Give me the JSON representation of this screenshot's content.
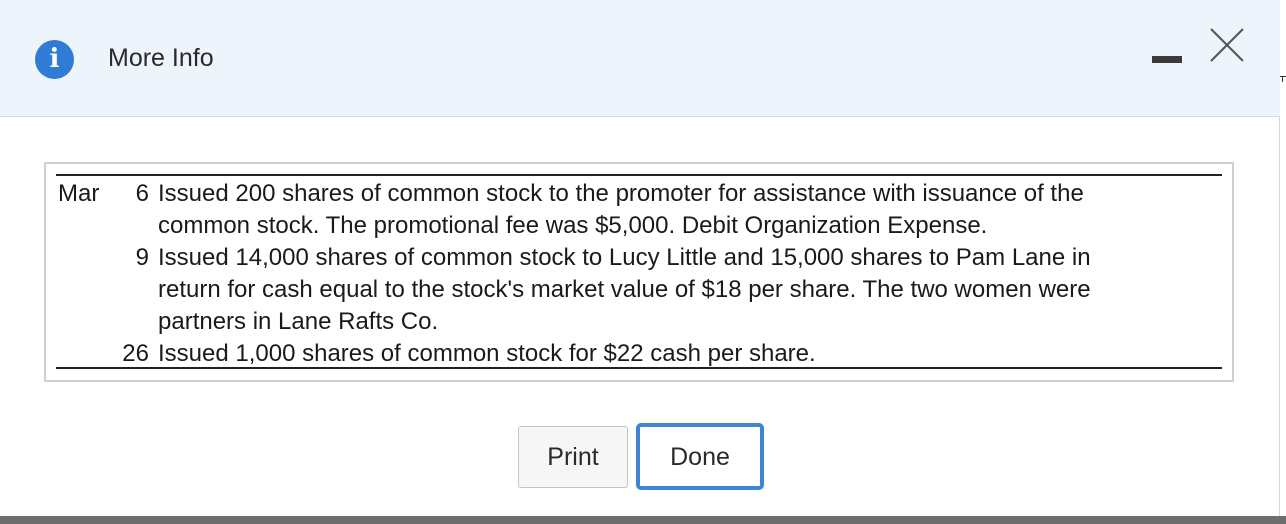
{
  "dialog": {
    "title": "More Info",
    "info_icon": "i",
    "minimize_icon": "minimize-icon",
    "close_icon": "close-icon"
  },
  "transactions": {
    "month": "Mar",
    "entries": [
      {
        "day": "6",
        "lines": [
          "Issued 200 shares of common stock to the promoter for assistance with issuance of the",
          "common stock. The promotional fee was $5,000. Debit Organization Expense."
        ]
      },
      {
        "day": "9",
        "lines": [
          "Issued 14,000 shares of common stock to Lucy Little and 15,000 shares to Pam Lane in",
          "return for cash equal to the stock's market value of $18 per share. The two women were",
          "partners in Lane Rafts Co."
        ]
      },
      {
        "day": "26",
        "lines": [
          "Issued 1,000 shares of common stock for $22 cash per share."
        ]
      }
    ]
  },
  "buttons": {
    "print_label": "Print",
    "done_label": "Done"
  },
  "colors": {
    "header_bg": "#eef4fb",
    "accent": "#2f7bd6",
    "focus_border": "#3d86d4"
  }
}
